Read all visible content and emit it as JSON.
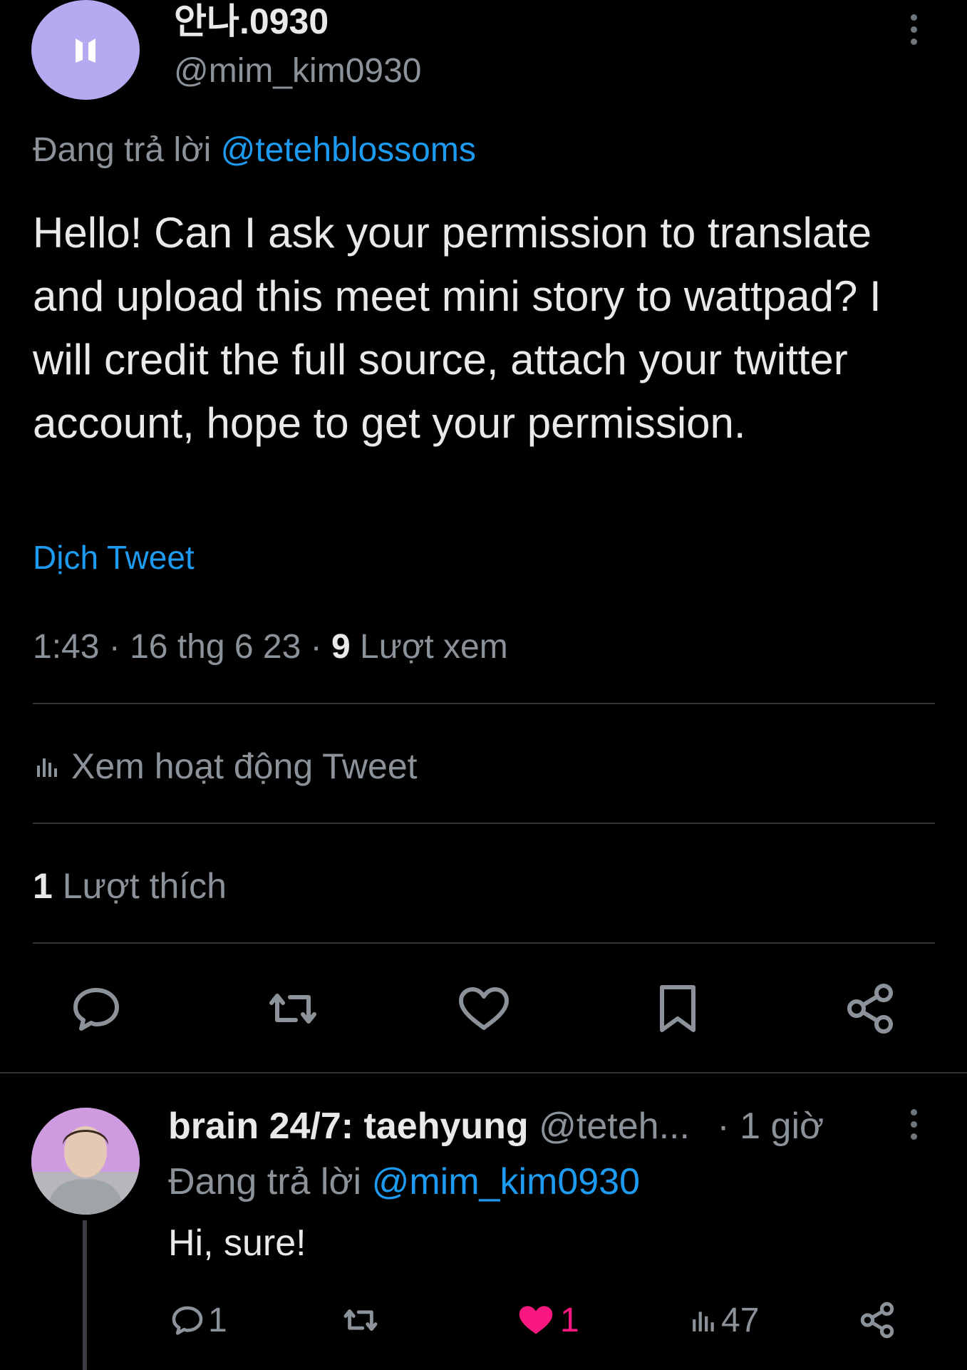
{
  "tweet": {
    "display_name": "안나.0930",
    "handle": "@mim_kim0930",
    "replying_prefix": "Đang trả lời",
    "replying_to": "@tetehblossoms",
    "text": "Hello! Can I ask your permission to translate and upload this meet mini story to wattpad? I will credit the full source, attach your twitter account, hope to get your permission.",
    "translate_label": "Dịch Tweet",
    "time": "1:43",
    "date": "16 thg 6 23",
    "views_count": "9",
    "views_label": "Lượt xem",
    "activity_label": "Xem hoạt động Tweet",
    "likes_count": "1",
    "likes_label": "Lượt thích",
    "avatar_bg": "#b7a9f0"
  },
  "actions": {
    "icons": [
      "reply-icon",
      "retweet-icon",
      "like-icon",
      "bookmark-icon",
      "share-icon"
    ]
  },
  "reply": {
    "display_name": "brain 24/7: taehyung",
    "handle": "@teteh...",
    "time": "· 1 giờ",
    "replying_prefix": "Đang trả lời",
    "replying_to": "@mim_kim0930",
    "text": "Hi, sure!",
    "reply_count": "1",
    "like_count": "1",
    "views_count": "47",
    "like_color": "#f91880"
  }
}
